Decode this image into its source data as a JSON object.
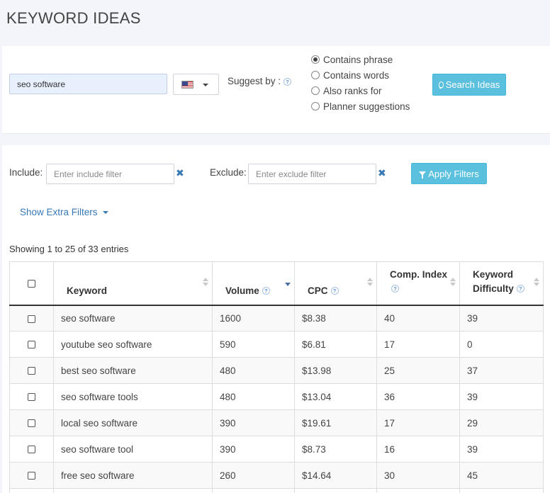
{
  "page": {
    "title": "KEYWORD IDEAS"
  },
  "search": {
    "query": "seo software",
    "suggest_label": "Suggest by :",
    "help_glyph": "?",
    "options": [
      {
        "label": "Contains phrase",
        "checked": true
      },
      {
        "label": "Contains words",
        "checked": false
      },
      {
        "label": "Also ranks for",
        "checked": false
      },
      {
        "label": "Planner suggestions",
        "checked": false
      }
    ],
    "button_label": "Search Ideas"
  },
  "filters": {
    "include_label": "Include:",
    "include_placeholder": "Enter include filter",
    "exclude_label": "Exclude:",
    "exclude_placeholder": "Enter exclude filter",
    "clear_glyph": "✖",
    "apply_label": "Apply Filters",
    "extra_label": "Show Extra Filters"
  },
  "table": {
    "info": "Showing 1 to 25 of 33 entries",
    "columns": {
      "keyword": "Keyword",
      "volume": "Volume",
      "cpc": "CPC",
      "comp_index": "Comp. Index",
      "difficulty_line1": "Keyword",
      "difficulty_line2": "Difficulty"
    },
    "rows": [
      {
        "keyword": "seo software",
        "volume": "1600",
        "cpc": "$8.38",
        "comp": "40",
        "difficulty": "39"
      },
      {
        "keyword": "youtube seo software",
        "volume": "590",
        "cpc": "$6.81",
        "comp": "17",
        "difficulty": "0"
      },
      {
        "keyword": "best seo software",
        "volume": "480",
        "cpc": "$13.98",
        "comp": "25",
        "difficulty": "37"
      },
      {
        "keyword": "seo software tools",
        "volume": "480",
        "cpc": "$13.04",
        "comp": "36",
        "difficulty": "39"
      },
      {
        "keyword": "local seo software",
        "volume": "390",
        "cpc": "$19.61",
        "comp": "17",
        "difficulty": "29"
      },
      {
        "keyword": "seo software tool",
        "volume": "390",
        "cpc": "$8.73",
        "comp": "16",
        "difficulty": "39"
      },
      {
        "keyword": "free seo software",
        "volume": "260",
        "cpc": "$14.64",
        "comp": "30",
        "difficulty": "45"
      },
      {
        "keyword": "",
        "volume": "",
        "cpc": "",
        "comp": "",
        "difficulty": ""
      }
    ]
  },
  "colors": {
    "accent": "#5bc0de",
    "link": "#3679b5",
    "input_bg": "#e8f0fe"
  }
}
